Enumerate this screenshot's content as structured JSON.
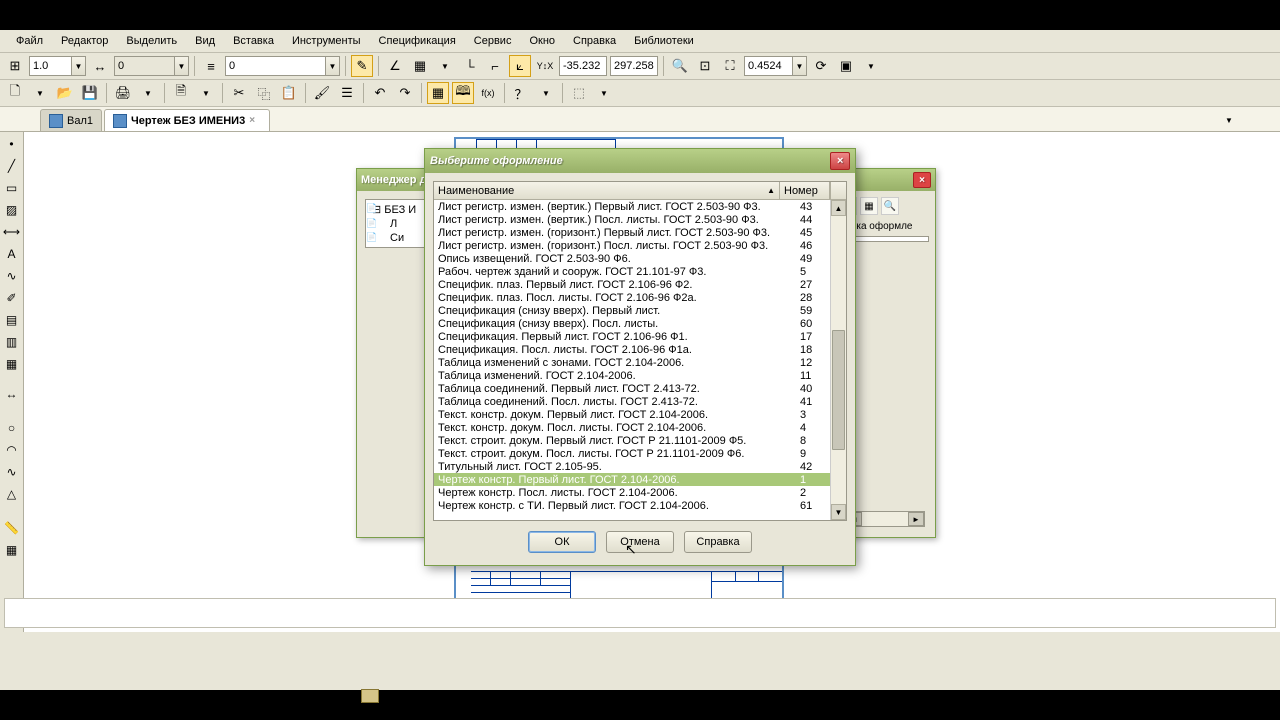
{
  "menu": [
    "Файл",
    "Редактор",
    "Выделить",
    "Вид",
    "Вставка",
    "Инструменты",
    "Спецификация",
    "Сервис",
    "Окно",
    "Справка",
    "Библиотеки"
  ],
  "toolbar1": {
    "scale_input": "1.0",
    "num_input": "0",
    "layer_input": "0",
    "coord_x": "-35.232",
    "coord_y": "297.258",
    "zoom": "0.4524"
  },
  "tabs": [
    {
      "label": "Вал1",
      "active": false
    },
    {
      "label": "Чертеж БЕЗ ИМЕНИ3",
      "active": true
    }
  ],
  "manager_dlg": {
    "title": "Менеджер д",
    "tree_root": "БЕЗ И",
    "tree_items": [
      "Л",
      "Си"
    ],
    "side_label": "отека оформле",
    "graphic_file": "graphic.lyt"
  },
  "fmt_dlg": {
    "title": "Выберите оформление",
    "col1": "Наименование",
    "col2": "Номер",
    "rows": [
      {
        "name": "Лист регистр. измен. (вертик.) Первый лист. ГОСТ 2.503-90 Ф3.",
        "num": "43"
      },
      {
        "name": "Лист регистр. измен. (вертик.) Посл. листы. ГОСТ 2.503-90 Ф3.",
        "num": "44"
      },
      {
        "name": "Лист регистр. измен. (горизонт.) Первый лист. ГОСТ 2.503-90 Ф3.",
        "num": "45"
      },
      {
        "name": "Лист регистр. измен. (горизонт.) Посл. листы. ГОСТ 2.503-90 Ф3.",
        "num": "46"
      },
      {
        "name": "Опись извещений. ГОСТ 2.503-90 Ф6.",
        "num": "49"
      },
      {
        "name": "Рабоч. чертеж зданий и сооруж. ГОСТ 21.101-97 Ф3.",
        "num": "5"
      },
      {
        "name": "Специфик. плаз. Первый лист. ГОСТ 2.106-96 Ф2.",
        "num": "27"
      },
      {
        "name": "Специфик. плаз. Посл. листы. ГОСТ 2.106-96 Ф2а.",
        "num": "28"
      },
      {
        "name": "Спецификация (снизу вверх). Первый лист.",
        "num": "59"
      },
      {
        "name": "Спецификация (снизу вверх). Посл. листы.",
        "num": "60"
      },
      {
        "name": "Спецификация. Первый лист. ГОСТ 2.106-96 Ф1.",
        "num": "17"
      },
      {
        "name": "Спецификация. Посл. листы. ГОСТ 2.106-96 Ф1а.",
        "num": "18"
      },
      {
        "name": "Таблица изменений с зонами. ГОСТ 2.104-2006.",
        "num": "12"
      },
      {
        "name": "Таблица изменений. ГОСТ 2.104-2006.",
        "num": "11"
      },
      {
        "name": "Таблица соединений. Первый лист. ГОСТ 2.413-72.",
        "num": "40"
      },
      {
        "name": "Таблица соединений. Посл. листы. ГОСТ 2.413-72.",
        "num": "41"
      },
      {
        "name": "Текст. констр. докум. Первый лист. ГОСТ 2.104-2006.",
        "num": "3"
      },
      {
        "name": "Текст. констр. докум. Посл. листы. ГОСТ 2.104-2006.",
        "num": "4"
      },
      {
        "name": "Текст. строит. докум. Первый лист. ГОСТ Р 21.1101-2009 Ф5.",
        "num": "8"
      },
      {
        "name": "Текст. строит. докум. Посл. листы. ГОСТ Р 21.1101-2009 Ф6.",
        "num": "9"
      },
      {
        "name": "Титульный лист. ГОСТ 2.105-95.",
        "num": "42"
      },
      {
        "name": "Чертеж констр. Первый лист. ГОСТ 2.104-2006.",
        "num": "1",
        "selected": true
      },
      {
        "name": "Чертеж констр. Посл. листы. ГОСТ 2.104-2006.",
        "num": "2"
      },
      {
        "name": "Чертеж констр. с ТИ. Первый лист. ГОСТ 2.104-2006.",
        "num": "61"
      }
    ],
    "ok": "ОК",
    "cancel": "Отмена",
    "help": "Справка"
  }
}
